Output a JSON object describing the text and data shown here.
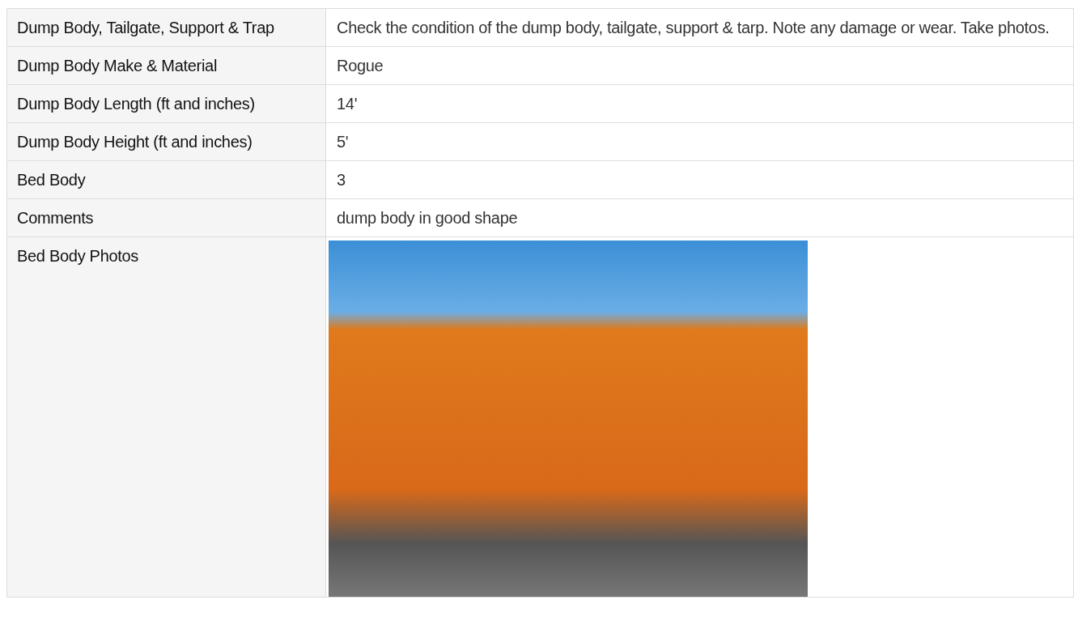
{
  "table": {
    "rows": [
      {
        "label": "Dump Body, Tailgate, Support & Trap",
        "value": "Check the condition of the dump body, tailgate, support & tarp. Note any damage or wear. Take photos.",
        "kind": "text"
      },
      {
        "label": "Dump Body Make & Material",
        "value": "Rogue",
        "kind": "text"
      },
      {
        "label": "Dump Body Length (ft and inches)",
        "value": "14'",
        "kind": "text"
      },
      {
        "label": "Dump Body Height (ft and inches)",
        "value": "5'",
        "kind": "text"
      },
      {
        "label": "Bed Body",
        "value": "3",
        "kind": "text"
      },
      {
        "label": "Comments",
        "value": "dump body in good shape",
        "kind": "text"
      },
      {
        "label": "Bed Body Photos",
        "kind": "photo"
      }
    ]
  }
}
